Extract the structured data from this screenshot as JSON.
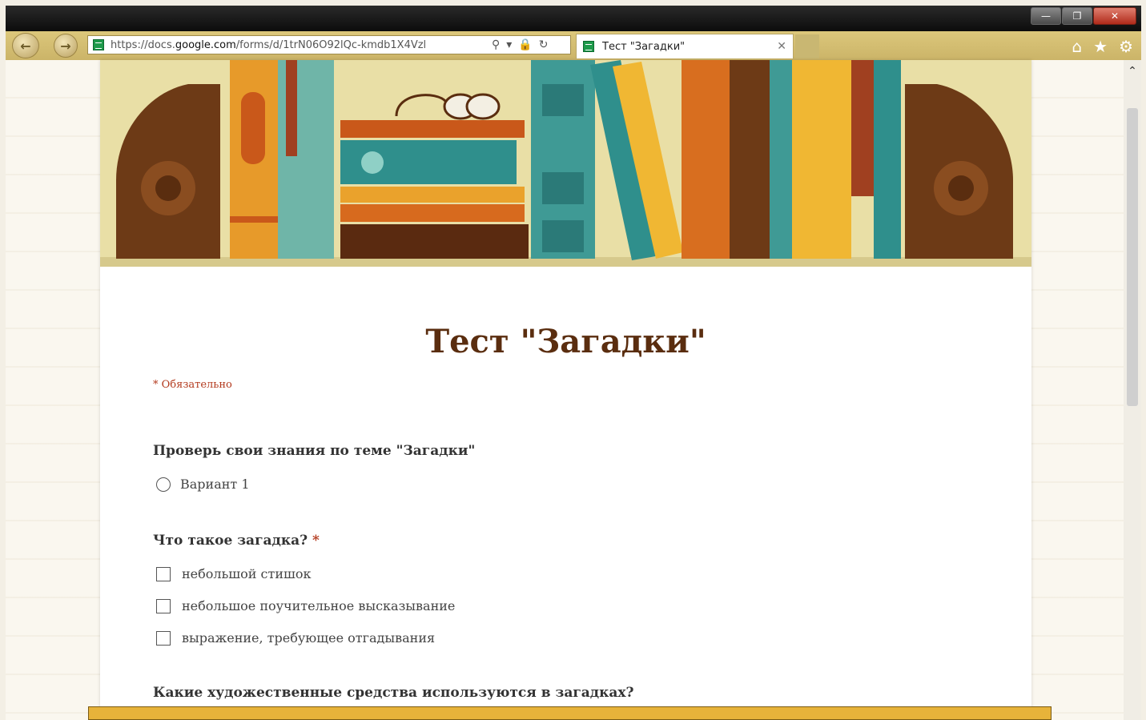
{
  "browser": {
    "url_prefix": "https://docs.",
    "url_domain": "google.com",
    "url_path": "/forms/d/1trN06O92lQc-kmdb1X4Vzl",
    "tab_title": "Тест \"Загадки\""
  },
  "form": {
    "title": "Тест \"Загадки\"",
    "required_note": "* Обязательно",
    "q1": {
      "label": "Проверь свои знания по теме \"Загадки\"",
      "option": "Вариант 1"
    },
    "q2": {
      "label": "Что такое загадка?",
      "star": " *",
      "options": [
        "небольшой стишок",
        "небольшое поучительное высказывание",
        "выражение, требующее отгадывания"
      ]
    },
    "q3": {
      "label": "Какие художественные средства используются в загадках?"
    }
  },
  "icons": [
    "back-icon",
    "forward-icon",
    "search-icon",
    "dropdown-icon",
    "lock-icon",
    "refresh-icon",
    "close-icon",
    "home-icon",
    "star-icon",
    "gear-icon",
    "minimize-icon",
    "restore-icon"
  ],
  "colors": {
    "accent": "#5a2d0f",
    "required": "#b33a1e",
    "nav": "#cdb66c"
  }
}
